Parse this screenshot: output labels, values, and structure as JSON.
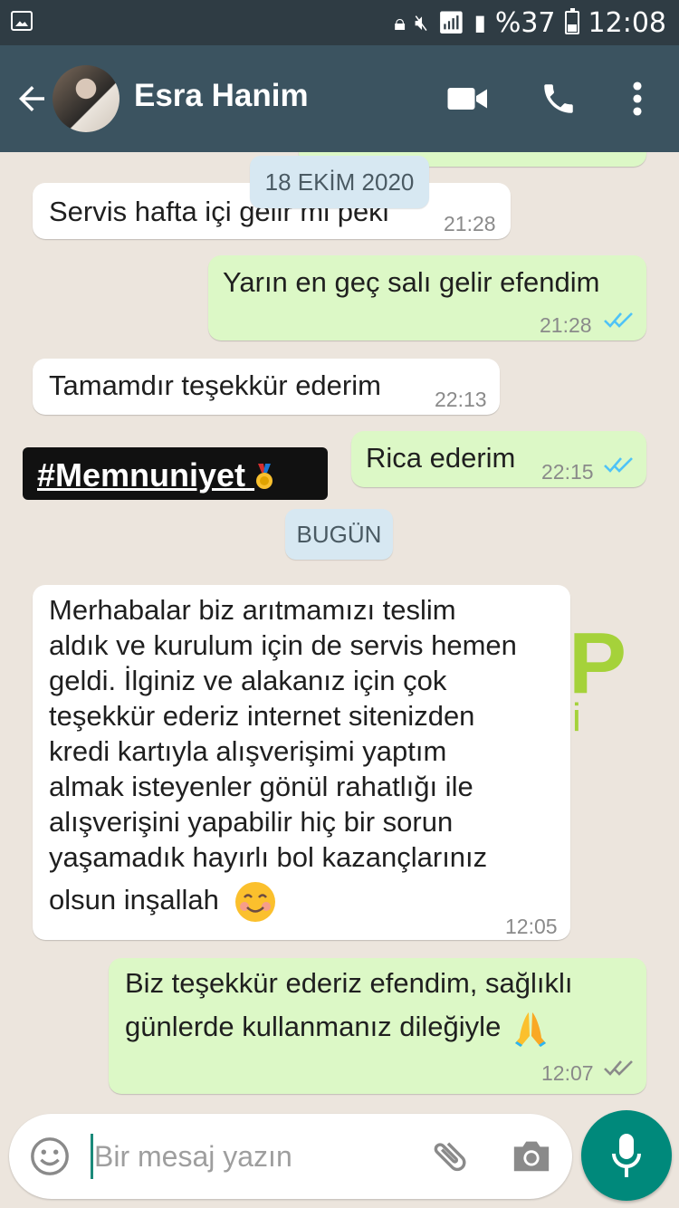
{
  "status_bar": {
    "battery": "%37",
    "time": "12:08",
    "icons": [
      "image-icon",
      "lock-icon",
      "mute-icon",
      "wifi-icon",
      "signal-icon",
      "battery-icon"
    ]
  },
  "header": {
    "contact_name": "Esra Hanim",
    "icons": [
      "back-arrow-icon",
      "avatar",
      "video-call-icon",
      "phone-icon",
      "more-vert-icon"
    ]
  },
  "chat": {
    "date_chip_1": "18 EKİM 2020",
    "date_chip_2": "BUGÜN",
    "hashtag": "#Memnuniyet",
    "messages": [
      {
        "dir": "in",
        "lines": [
          "Servis hafta içi gelir mi peki"
        ],
        "time": "21:28"
      },
      {
        "dir": "out",
        "lines": [
          "Yarın en geç salı gelir efendim"
        ],
        "time": "21:28",
        "ticks": "read"
      },
      {
        "dir": "in",
        "lines": [
          "Tamamdır teşekkür ederim"
        ],
        "time": "22:13"
      },
      {
        "dir": "out",
        "lines": [
          "Rica ederim"
        ],
        "time": "22:15",
        "ticks": "read"
      },
      {
        "dir": "in",
        "lines": [
          "Merhabalar biz arıtmamızı teslim",
          "aldık ve kurulum için de servis hemen",
          "geldi. İlginiz  ve alakanız için çok",
          "teşekkür ederiz internet sitenizden",
          "kredi kartıyla alışverişimi yaptım",
          "almak isteyenler gönül rahatlığı ile",
          "alışverişini yapabilir hiç bir sorun",
          "yaşamadık hayırlı bol kazançlarınız",
          "olsun inşallah"
        ],
        "emoji": "smiling-face-icon",
        "time": "12:05"
      },
      {
        "dir": "out",
        "lines": [
          "Biz teşekkür ederiz efendim, sağlıklı",
          "günlerde kullanmanız dileğiyle"
        ],
        "emoji": "praying-hands-icon",
        "time": "12:07",
        "ticks": "delivered"
      }
    ]
  },
  "input": {
    "placeholder": "Bir mesaj yazın",
    "icons": [
      "emoji-icon",
      "attach-icon",
      "camera-icon",
      "mic-icon"
    ]
  },
  "colors": {
    "header": "#3b5360",
    "status_bar": "#2f3c44",
    "outgoing_bubble": "#dcf8c6",
    "incoming_bubble": "#ffffff",
    "chat_bg": "#ece5dd",
    "read_ticks": "#4fc3f7",
    "mic_button": "#00897b"
  }
}
